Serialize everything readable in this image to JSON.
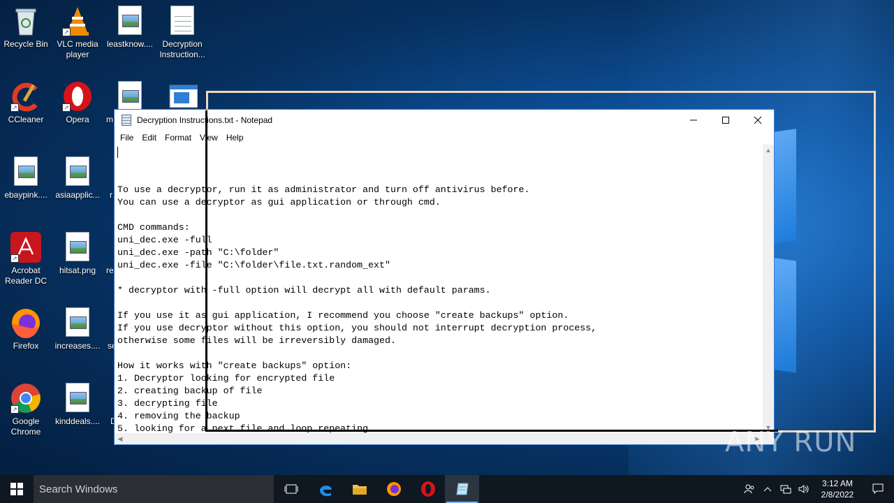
{
  "desktop": {
    "icons": [
      {
        "label": "Recycle Bin",
        "icon": "recycle-bin-icon"
      },
      {
        "label": "VLC media player",
        "icon": "vlc-icon"
      },
      {
        "label": "leastknow....",
        "icon": "image-file-icon"
      },
      {
        "label": "Decryption Instruction...",
        "icon": "text-file-icon"
      },
      {
        "label": "CCleaner",
        "icon": "ccleaner-icon"
      },
      {
        "label": "Opera",
        "icon": "opera-icon"
      },
      {
        "label": "m",
        "icon": "image-file-icon"
      },
      {
        "label": "ebaypink....",
        "icon": "image-file-icon"
      },
      {
        "label": "asiaapplic...",
        "icon": "image-file-icon"
      },
      {
        "label": "r",
        "icon": "image-file-icon"
      },
      {
        "label": "Acrobat Reader DC",
        "icon": "acrobat-icon"
      },
      {
        "label": "hitsat.png",
        "icon": "image-file-icon"
      },
      {
        "label": "re",
        "icon": "image-file-icon"
      },
      {
        "label": "Firefox",
        "icon": "firefox-icon"
      },
      {
        "label": "increases....",
        "icon": "image-file-icon"
      },
      {
        "label": "se",
        "icon": "image-file-icon"
      },
      {
        "label": "Google Chrome",
        "icon": "chrome-icon"
      },
      {
        "label": "kinddeals....",
        "icon": "image-file-icon"
      },
      {
        "label": "D",
        "icon": "image-file-icon"
      }
    ]
  },
  "notepad": {
    "title": "Decryption Instructions.txt - Notepad",
    "menu": [
      "File",
      "Edit",
      "Format",
      "View",
      "Help"
    ],
    "lines": [
      "To use a decryptor, run it as administrator and turn off antivirus before.",
      "You can use a decryptor as gui application or through cmd.",
      "",
      "CMD commands:",
      "uni_dec.exe -full",
      "uni_dec.exe -path \"C:\\folder\"",
      "uni_dec.exe -file \"C:\\folder\\file.txt.random_ext\"",
      "",
      "* decryptor with -full option will decrypt all with default params.",
      "",
      "If you use it as gui application, I recommend you choose \"create backups\" option.",
      "If you use decryptor without this option, you should not interrupt decryption process,",
      "otherwise some files will be irreversibly damaged.",
      "",
      "How it works with \"create backups\" option:",
      "1. Decryptor looking for encrypted file",
      "2. creating backup of file",
      "3. decrypting file",
      "4. removing the backup",
      "5. looking for a next file and loop repeating."
    ]
  },
  "watermark": "ANY RUN",
  "taskbar": {
    "search_placeholder": "Search Windows",
    "apps": [
      "task-view-icon",
      "edge-icon",
      "file-explorer-icon",
      "firefox-icon",
      "opera-icon",
      "notepad-icon"
    ],
    "time": "3:12 AM",
    "date": "2/8/2022"
  },
  "colors": {
    "frame_outline": "#f0d8bc",
    "taskbar_bg": "#0f1720",
    "accent": "#3a7bd5"
  }
}
